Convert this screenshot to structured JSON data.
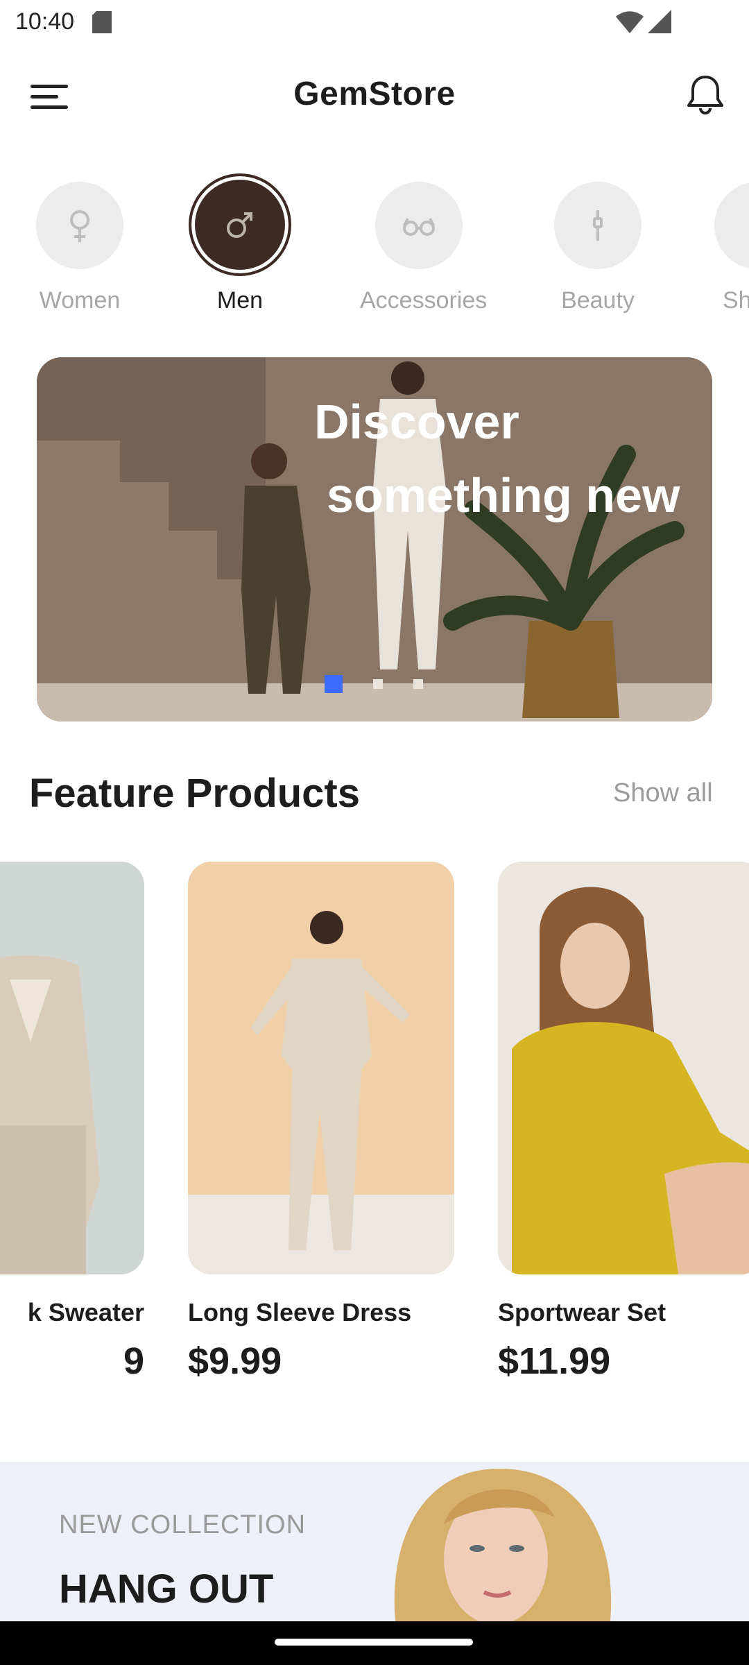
{
  "status_bar": {
    "time": "10:40"
  },
  "header": {
    "title": "GemStore"
  },
  "categories": [
    {
      "label": "Women",
      "icon": "female-icon"
    },
    {
      "label": "Men",
      "icon": "male-icon",
      "selected": true
    },
    {
      "label": "Accessories",
      "icon": "glasses-icon"
    },
    {
      "label": "Beauty",
      "icon": "makeup-brush-icon"
    },
    {
      "label": "Sh"
    }
  ],
  "banner": {
    "title_line1": "Discover",
    "title_line2": "something new",
    "page_count": 3,
    "active_page": 1,
    "colors": {
      "active_dot": "#3b6cff",
      "inactive_dot": "#e9e4dc"
    }
  },
  "featured": {
    "title": "Feature Products",
    "show_all": "Show all",
    "products": [
      {
        "name": "k Sweater",
        "price": "9"
      },
      {
        "name": "Long Sleeve Dress",
        "price": "$9.99"
      },
      {
        "name": "Sportwear Set",
        "price": "$11.99"
      }
    ]
  },
  "collection": {
    "subtitle": "NEW COLLECTION",
    "title": "HANG OUT"
  },
  "colors": {
    "accent_dark": "#3d2a25",
    "muted_text": "#a6a6a6",
    "collection_bg": "#eef0f8"
  }
}
